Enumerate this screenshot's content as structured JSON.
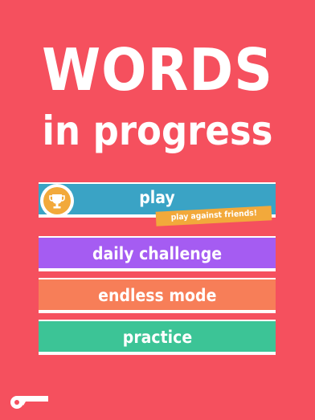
{
  "title": {
    "main": "WORDS",
    "sub": "in progress"
  },
  "menu": {
    "play": {
      "label": "play",
      "ribbon": "play against friends!",
      "icon": "trophy-icon"
    },
    "daily_challenge": {
      "label": "daily challenge"
    },
    "endless_mode": {
      "label": "endless mode"
    },
    "practice": {
      "label": "practice"
    }
  },
  "bottom": {
    "icon": "whistle-icon"
  },
  "colors": {
    "background": "#f5505e",
    "play": "#3aa3c5",
    "daily_challenge": "#a55cf2",
    "endless_mode": "#f77e58",
    "practice": "#3cc496",
    "accent": "#f2a93b"
  }
}
